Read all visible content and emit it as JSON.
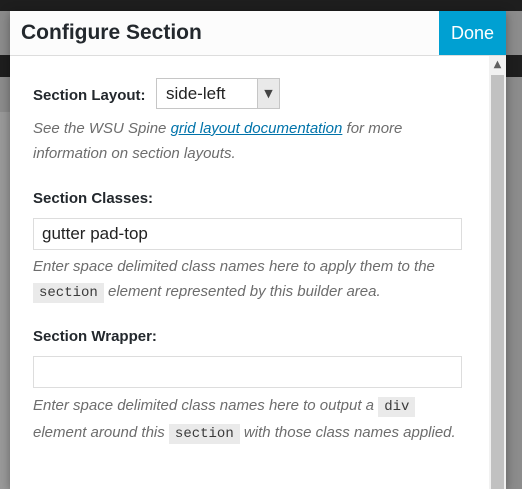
{
  "modal": {
    "title": "Configure Section",
    "done_label": "Done"
  },
  "section_layout": {
    "label": "Section Layout:",
    "selected": "side-left",
    "help_prefix": "See the WSU Spine ",
    "help_link": "grid layout documentation",
    "help_suffix": " for more information on section layouts."
  },
  "section_classes": {
    "label": "Section Classes:",
    "value": "gutter pad-top",
    "placeholder": "",
    "help_prefix": "Enter space delimited class names here to apply them to the ",
    "help_code": "section",
    "help_suffix": " element represented by this builder area."
  },
  "section_wrapper": {
    "label": "Section Wrapper:",
    "value": "",
    "placeholder": "",
    "help_prefix": "Enter space delimited class names here to output a ",
    "help_code1": "div",
    "help_middle": " element around this ",
    "help_code2": "section",
    "help_suffix": " with those class names applied."
  },
  "icons": {
    "scroll_up": "chevron-up-icon",
    "select_arrow": "chevron-down-icon"
  },
  "colors": {
    "accent": "#00a0d2",
    "link": "#0073aa",
    "backdrop": "#8c8c8c"
  }
}
